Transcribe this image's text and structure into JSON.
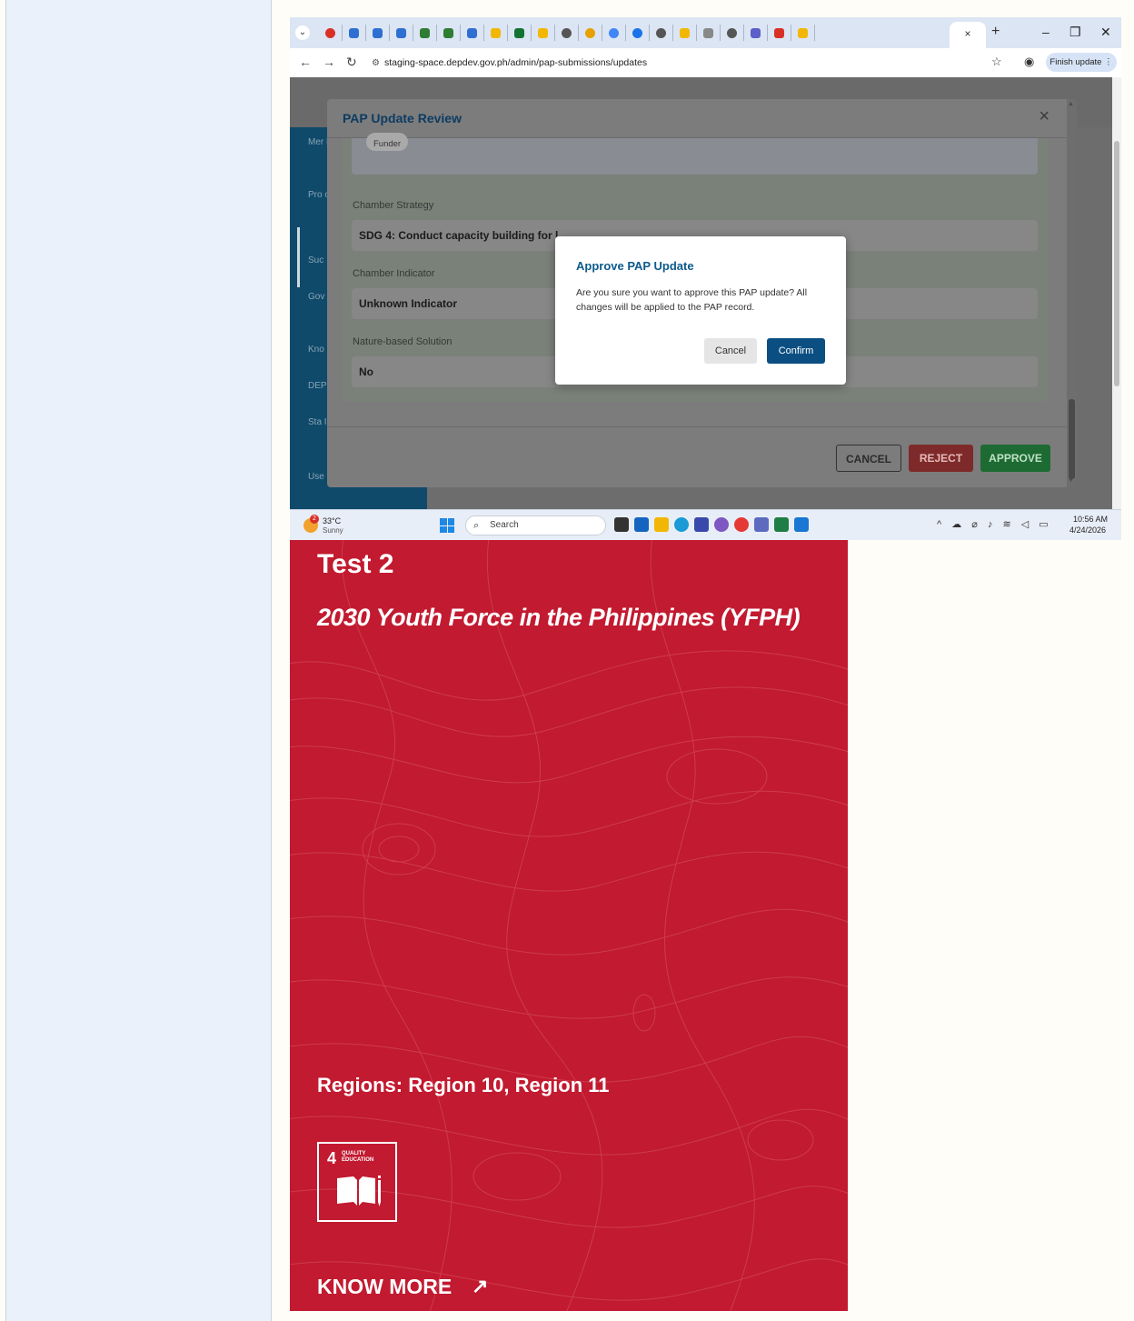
{
  "browser": {
    "active_tab_close": "×",
    "new_tab": "+",
    "minimize": "–",
    "restore": "❐",
    "close": "✕",
    "url": "staging-space.depdev.gov.ph/admin/pap-submissions/updates",
    "finish_update": "Finish update"
  },
  "sidebar": {
    "items": [
      "Mer Req",
      "Pro or F Ma",
      "Suc",
      "Gov Are",
      "Kno",
      "DEP",
      "Sta Indi",
      "Use"
    ]
  },
  "modal": {
    "title": "PAP Update Review",
    "funder_chip": "Funder",
    "fields": [
      {
        "label": "Chamber Strategy",
        "value": "SDG 4: Conduct capacity building for l"
      },
      {
        "label": "Chamber Indicator",
        "value": "Unknown Indicator"
      },
      {
        "label": "Nature-based Solution",
        "value": "No"
      }
    ],
    "cancel": "CANCEL",
    "reject": "REJECT",
    "approve": "APPROVE"
  },
  "dialog": {
    "title": "Approve PAP Update",
    "message": "Are you sure you want to approve this PAP update? All changes will be applied to the PAP record.",
    "cancel": "Cancel",
    "confirm": "Confirm"
  },
  "taskbar": {
    "weather_badge": "2",
    "temp": "33°C",
    "condition": "Sunny",
    "search_placeholder": "Search",
    "time": "10:56 AM",
    "date": "4/24/2026"
  },
  "card": {
    "title": "Test 2",
    "subtitle": "2030 Youth Force in the Philippines (YFPH)",
    "regions": "Regions: Region 10, Region 11",
    "sdg_number": "4",
    "sdg_label_1": "QUALITY",
    "sdg_label_2": "EDUCATION",
    "know_more": "KNOW MORE",
    "arrow": "↗"
  },
  "colors": {
    "card_red": "#c21a30",
    "confirm_blue": "#0b4e82",
    "sidebar_navy": "#0f4a6b"
  }
}
